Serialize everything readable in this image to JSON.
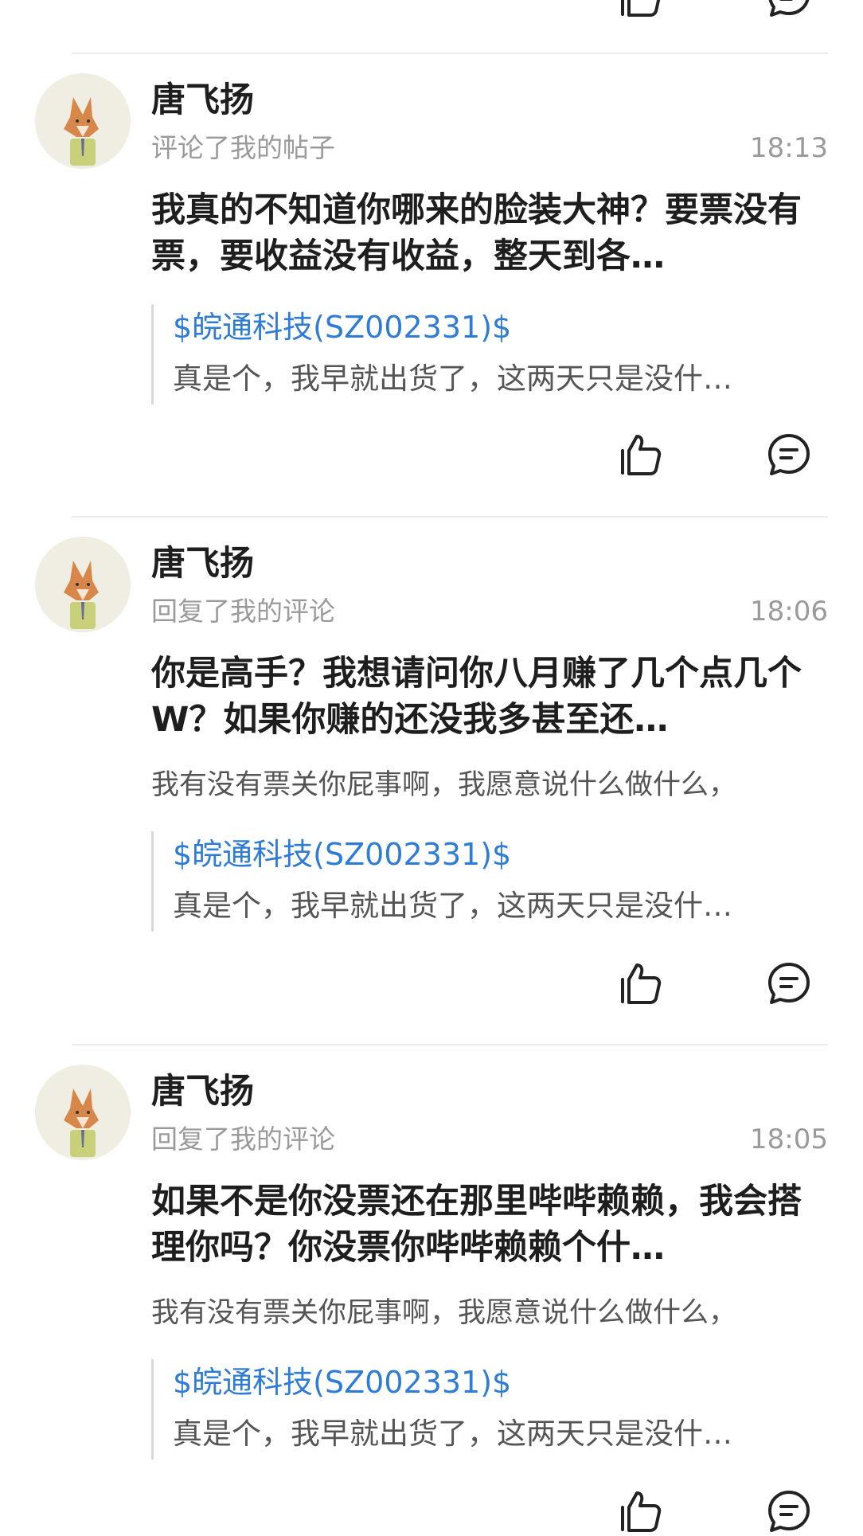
{
  "icons": {
    "like": "thumbs-up-icon",
    "comment": "comment-bubble-icon",
    "avatar": "fox-avatar"
  },
  "colors": {
    "link": "#2e7cd6",
    "meta": "#9a9a9a",
    "text": "#1e1e1e"
  },
  "notifications": [
    {
      "user": "唐飞扬",
      "action": "评论了我的帖子",
      "time": "18:13",
      "content": "我真的不知道你哪来的脸装大神？要票没有票，要收益没有收益，整天到各…",
      "reply_to": "",
      "quote_link": "$皖通科技(SZ002331)$",
      "quote_text": "真是个，我早就出货了，这两天只是没什…"
    },
    {
      "user": "唐飞扬",
      "action": "回复了我的评论",
      "time": "18:06",
      "content": "你是高手？我想请问你八月赚了几个点几个W？如果你赚的还没我多甚至还…",
      "reply_to": "我有没有票关你屁事啊，我愿意说什么做什么，",
      "quote_link": "$皖通科技(SZ002331)$",
      "quote_text": "真是个，我早就出货了，这两天只是没什…"
    },
    {
      "user": "唐飞扬",
      "action": "回复了我的评论",
      "time": "18:05",
      "content": "如果不是你没票还在那里哔哔赖赖，我会搭理你吗？你没票你哔哔赖赖个什…",
      "reply_to": "我有没有票关你屁事啊，我愿意说什么做什么，",
      "quote_link": "$皖通科技(SZ002331)$",
      "quote_text": "真是个，我早就出货了，这两天只是没什…"
    }
  ]
}
